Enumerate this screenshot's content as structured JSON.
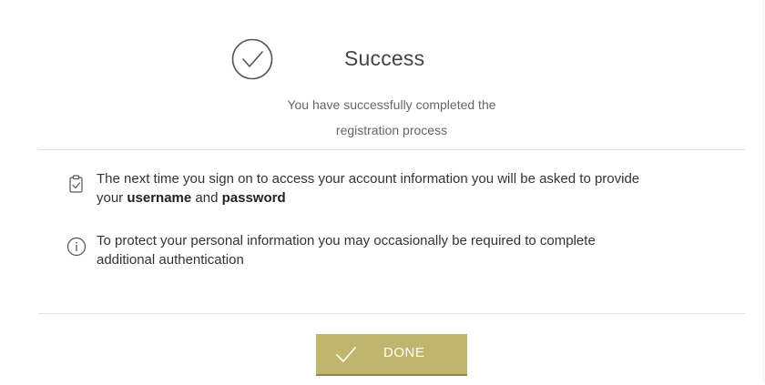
{
  "success": {
    "icon": "check-circle-icon",
    "title": "Success",
    "subtitle_line1": "You have successfully completed the",
    "subtitle_line2": "registration process"
  },
  "info": {
    "items": [
      {
        "icon": "clipboard-check-icon",
        "line1": "The next time you sign on to access your account information you will be asked to provide",
        "line2_prefix": "your ",
        "username": "username",
        "line2_and": " and ",
        "password": "password"
      },
      {
        "icon": "info-circle-icon",
        "line1": "To protect your personal information you may occasionally be required to complete",
        "line2": "additional authentication"
      }
    ]
  },
  "done_button": {
    "icon": "check-icon",
    "label": "DONE"
  },
  "colors": {
    "accent": "#bfb56c",
    "accent_shadow": "#8e8752",
    "divider": "#e2e2e2",
    "text": "#333333",
    "muted_text": "#666666"
  }
}
